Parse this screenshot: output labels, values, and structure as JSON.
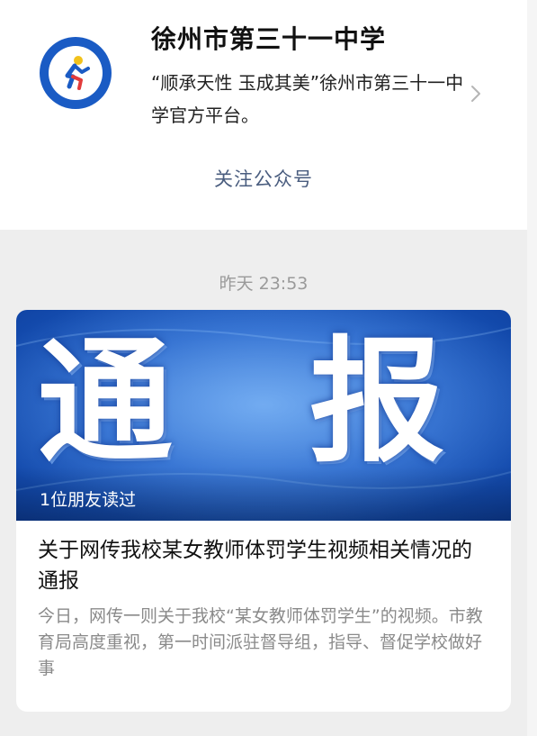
{
  "account": {
    "name": "徐州市第三十一中学",
    "description": "“顺承天性 玉成其美”徐州市第三十一中学官方平台。",
    "follow_label": "关注公众号",
    "logo_icon": "school-logo-icon"
  },
  "feed": {
    "timestamp": "昨天 23:53"
  },
  "article": {
    "cover_text": "通 报",
    "read_by_friends": "1位朋友读过",
    "title": "关于网传我校某女教师体罚学生视频相关情况的通报",
    "summary": "今日，网传一则关于我校“某女教师体罚学生”的视频。市教育局高度重视，第一时间派驻督导组，指导、督促学校做好事"
  },
  "colors": {
    "follow_link": "#4a5d7f",
    "logo_blue": "#1a5bc4",
    "cover_blue": "#1f5fc7",
    "page_bg": "#eeeeee"
  }
}
